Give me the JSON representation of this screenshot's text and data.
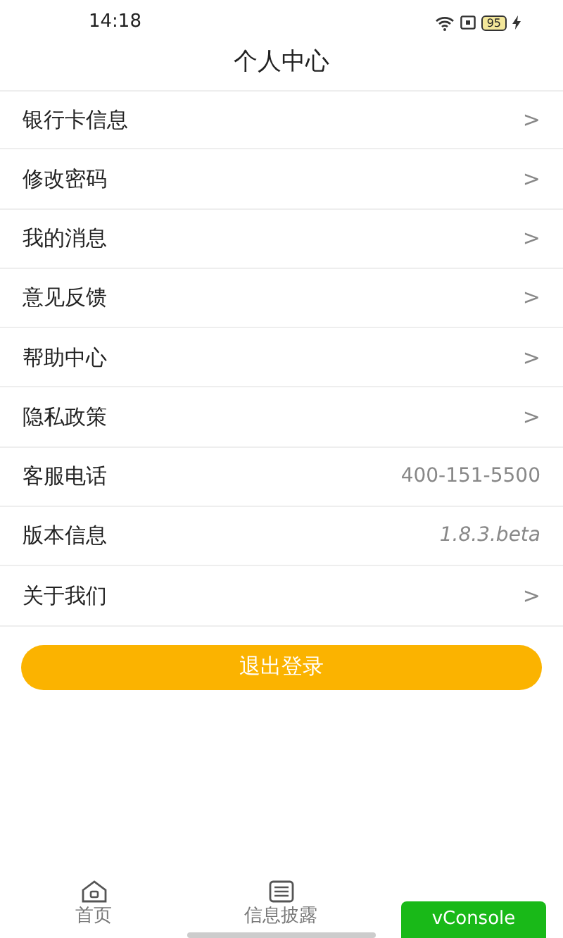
{
  "status_bar": {
    "time": "14:18",
    "battery": "95"
  },
  "header": {
    "title": "个人中心"
  },
  "menu": [
    {
      "label": "银行卡信息",
      "kind": "link"
    },
    {
      "label": "修改密码",
      "kind": "link"
    },
    {
      "label": "我的消息",
      "kind": "link"
    },
    {
      "label": "意见反馈",
      "kind": "link"
    },
    {
      "label": "帮助中心",
      "kind": "link"
    },
    {
      "label": "隐私政策",
      "kind": "link"
    },
    {
      "label": "客服电话",
      "kind": "value",
      "value": "400-151-5500"
    },
    {
      "label": "版本信息",
      "kind": "version",
      "value": "1.8.3.beta"
    },
    {
      "label": "关于我们",
      "kind": "link"
    }
  ],
  "chevron": ">",
  "logout_button": "退出登录",
  "tab_bar": [
    {
      "label": "首页",
      "kind": "home"
    },
    {
      "label": "信息披露",
      "kind": "list"
    }
  ],
  "debug_button": "vConsole"
}
